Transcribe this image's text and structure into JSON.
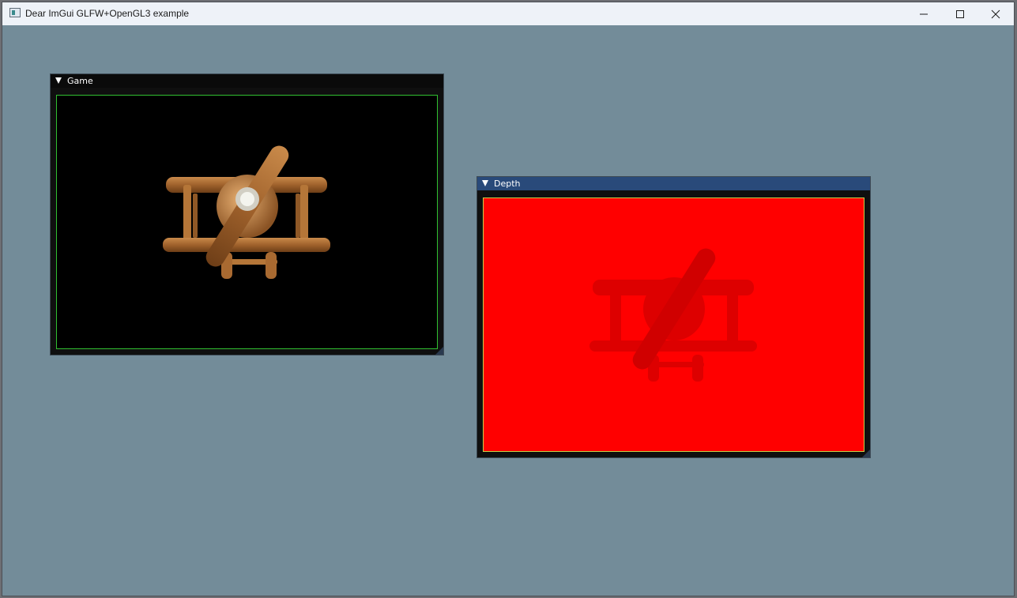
{
  "os_window": {
    "title": "Dear ImGui GLFW+OpenGL3 example"
  },
  "window_controls": {
    "minimize_icon": "minimize-icon",
    "maximize_icon": "maximize-icon",
    "close_icon": "close-icon"
  },
  "panels": {
    "game": {
      "title": "Game",
      "viewport_image": "biplane-render"
    },
    "depth": {
      "title": "Depth",
      "viewport_image": "biplane-depth-buffer"
    }
  },
  "colors": {
    "background": "#738c99",
    "game_border": "#30c030",
    "depth_fill": "#ff0000",
    "active_title": "#294a7a"
  }
}
